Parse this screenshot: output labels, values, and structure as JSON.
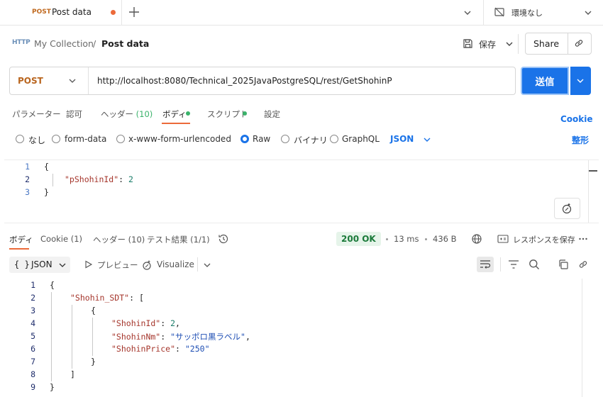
{
  "tabbar": {
    "active_tab": {
      "method": "POST",
      "name": "Post data"
    },
    "environment": "環境なし"
  },
  "breadcrumb": {
    "icon_label": "HTTP",
    "collection": "My Collection",
    "separator": "/",
    "current": "Post data"
  },
  "actions": {
    "save_label": "保存",
    "share_label": "Share"
  },
  "request": {
    "method": "POST",
    "url": "http://localhost:8080/Technical_2025JavaPostgreSQL/rest/GetShohinP",
    "send_label": "送信"
  },
  "request_tabs": {
    "params": "パラメーター",
    "auth": "認可",
    "headers": "ヘッダー",
    "headers_count": "(10)",
    "body": "ボディ",
    "scripts": "スクリプト",
    "settings": "設定",
    "cookie_link": "Cookie"
  },
  "body_types": {
    "none": "なし",
    "form_data": "form-data",
    "urlencoded": "x-www-form-urlencoded",
    "raw": "Raw",
    "binary": "バイナリ",
    "graphql": "GraphQL",
    "format": "JSON",
    "beautify": "整形",
    "selected": "raw"
  },
  "request_body": {
    "line_numbers": [
      "1",
      "2",
      "3"
    ],
    "open": "{",
    "key": "\"pShohinId\"",
    "colon": ": ",
    "value": "2",
    "close": "}"
  },
  "response_tabs": {
    "body": "ボディ",
    "cookie": "Cookie",
    "cookie_count": "(1)",
    "headers": "ヘッダー",
    "headers_count": "(10)",
    "tests": "テスト結果",
    "tests_count": "(1/1)"
  },
  "response_meta": {
    "status": "200 OK",
    "time": "13 ms",
    "size": "436 B",
    "save_response": "レスポンスを保存"
  },
  "response_toolbar": {
    "braces": "{ }",
    "format": "JSON",
    "preview": "プレビュー",
    "visualize": "Visualize"
  },
  "response_body": {
    "line_numbers": [
      "1",
      "2",
      "3",
      "4",
      "5",
      "6",
      "7",
      "8",
      "9"
    ],
    "l1": "{",
    "l2_key": "\"Shohin_SDT\"",
    "l2_rest": ": [",
    "l3": "{",
    "l4_key": "\"ShohinId\"",
    "l4_colon": ": ",
    "l4_val": "2",
    "l4_end": ",",
    "l5_key": "\"ShohinNm\"",
    "l5_colon": ": ",
    "l5_val": "\"サッポロ黒ラベル\"",
    "l5_end": ",",
    "l6_key": "\"ShohinPrice\"",
    "l6_colon": ": ",
    "l6_val": "\"250\"",
    "l7": "}",
    "l8": "]",
    "l9": "}"
  },
  "colors": {
    "accent": "#1a73e8",
    "method": "#b9651e",
    "active_tab_underline": "#ec6a3a",
    "status_ok": "#1b7a3a",
    "tab_indicator": "#3ab26a"
  }
}
